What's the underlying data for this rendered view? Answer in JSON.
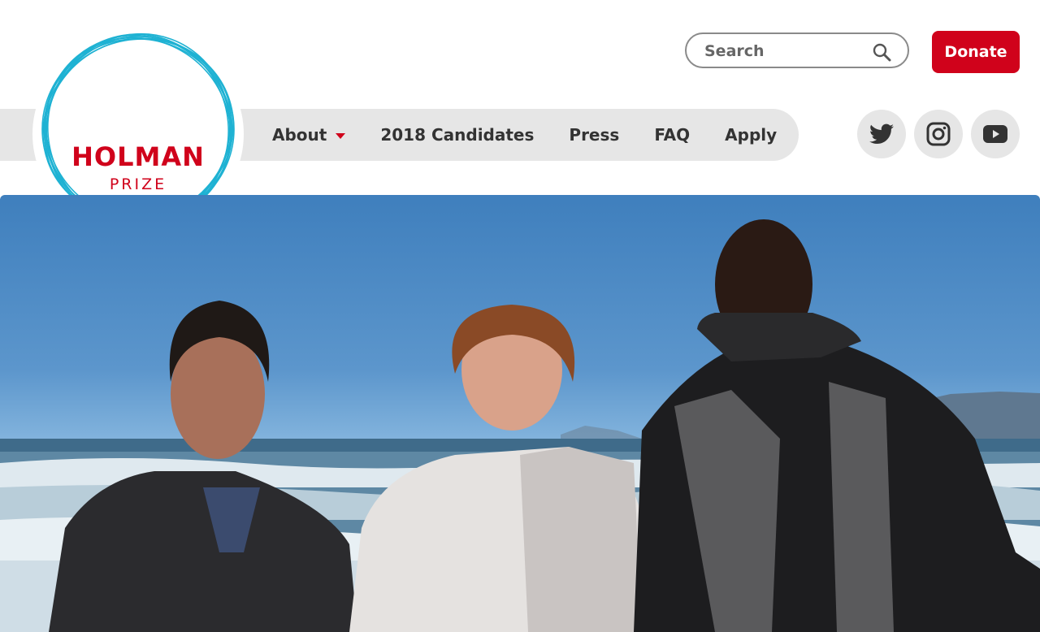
{
  "logo": {
    "title": "HOLMAN",
    "subtitle": "PRIZE",
    "ring_color": "#1fb2d3",
    "text_color": "#d0021b"
  },
  "search": {
    "placeholder": "Search",
    "icon": "search-icon"
  },
  "donate": {
    "label": "Donate",
    "color": "#d0021b"
  },
  "nav": {
    "items": [
      {
        "label": "About",
        "has_dropdown": true
      },
      {
        "label": "2018 Candidates"
      },
      {
        "label": "Press"
      },
      {
        "label": "FAQ"
      },
      {
        "label": "Apply"
      }
    ]
  },
  "social": [
    {
      "icon": "twitter-icon"
    },
    {
      "icon": "instagram-icon"
    },
    {
      "icon": "youtube-icon"
    }
  ],
  "hero": {
    "image": "beach-group-photo"
  }
}
